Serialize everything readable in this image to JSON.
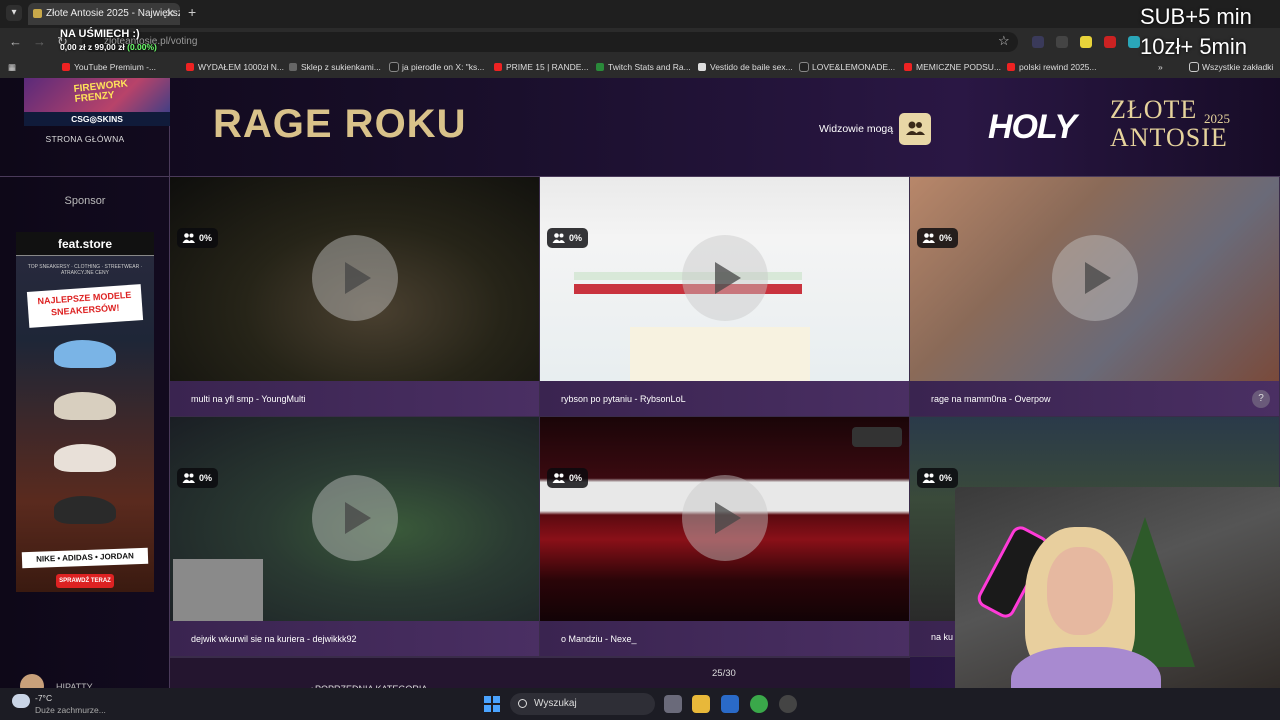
{
  "browser": {
    "tab_title": "Złote Antosie 2025 - Największ",
    "url": "zloteantosie.pl/voting",
    "bookmarks": [
      "YouTube Premium -...",
      "WYDAŁEM 1000zł N...",
      "Sklep z sukienkami...",
      "ja pierodle on X: \"ks...",
      "PRIME 15 | RANDE...",
      "Twitch Stats and Ra...",
      "Vestido de baile sex...",
      "LOVE&LEMONADE...",
      "MEMICZNE PODSU...",
      "polski rewind 2025..."
    ],
    "all_bookmarks": "Wszystkie zakładki"
  },
  "stream_overlay": {
    "donation_title": "NA UŚMIECH :)",
    "donation_amount": "0,00 zł z 99,00 zł",
    "donation_percent": "(0.00%)",
    "sub_line1": "SUB+5 min",
    "sub_line2": "10zł+ 5min"
  },
  "sidebar": {
    "promo_label": "FIREWORK FRENZY",
    "promo_brand": "CSG◎SKINS",
    "home_link": "STRONA GŁÓWNA",
    "sponsor_label": "Sponsor",
    "ad": {
      "brand": "feat.store",
      "subtitle": "TOP SNEAKERSY · CLOTHING · STREETWEAR · ATRAKCYJNE CENY",
      "banner": "NAJLEPSZE MODELE SNEAKERSÓW!",
      "brands": "NIKE • ADIDAS • JORDAN",
      "cta": "SPRAWDŹ TERAZ"
    },
    "user_name": "HIPATTY"
  },
  "header": {
    "title": "RAGE ROKU",
    "audience_label": "Widzowie mogą",
    "logo_holy": "HOLY",
    "logo_line1": "ZŁOTE",
    "logo_line2": "ANTOSIE",
    "logo_year": "2025"
  },
  "cards": [
    {
      "caption": "multi na yfl smp - YoungMulti",
      "percent": "0%"
    },
    {
      "caption": "rybson po pytaniu - RybsonLoL",
      "percent": "0%"
    },
    {
      "caption": "rage na mamm0na - Overpow",
      "percent": "0%"
    },
    {
      "caption": "dejwik wkurwil sie na kuriera - dejwikkk92",
      "percent": "0%"
    },
    {
      "caption": "o Mandziu - Nexe_",
      "percent": "0%"
    },
    {
      "caption": "na ku",
      "percent": "0%"
    }
  ],
  "card_help": "?",
  "bottom_nav": {
    "prev": "POPRZEDNIA KATEGORIA",
    "page": "25/30"
  },
  "taskbar": {
    "temperature": "-7°C",
    "weather": "Duże zachmurze...",
    "search_placeholder": "Wyszukaj"
  }
}
